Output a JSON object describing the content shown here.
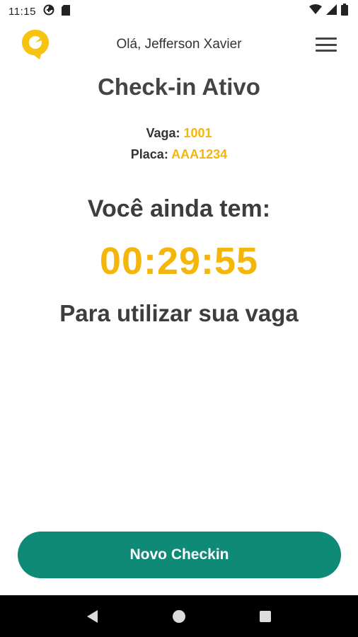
{
  "status_bar": {
    "time": "11:15",
    "icons_left": [
      "data-saver-icon",
      "sim-card-icon"
    ],
    "icons_right": [
      "wifi-icon",
      "cell-signal-icon",
      "battery-icon"
    ]
  },
  "header": {
    "greeting": "Olá, Jefferson Xavier",
    "logo_icon": "location-pin-logo-icon",
    "menu_icon": "hamburger-menu-icon"
  },
  "checkin": {
    "title": "Check-in Ativo",
    "vaga_label": "Vaga: ",
    "vaga_value": "1001",
    "placa_label": "Placa: ",
    "placa_value": "AAA1234",
    "remaining_label": "Você ainda tem:",
    "timer": "00:29:55",
    "subtext": "Para utilizar sua vaga"
  },
  "actions": {
    "novo_checkin": "Novo Checkin"
  },
  "nav_bar": {
    "back_icon": "back-triangle-icon",
    "home_icon": "home-circle-icon",
    "recents_icon": "recents-square-icon"
  },
  "colors": {
    "accent": "#f5b60b",
    "button": "#0f8a76",
    "text": "#3d3d3d"
  }
}
